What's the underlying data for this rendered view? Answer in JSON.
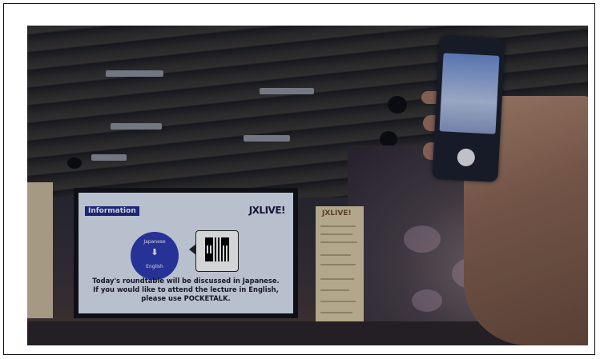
{
  "screen": {
    "info_label": "Information",
    "logo_text": "JXLIVE!",
    "circle_top": "Japanese",
    "circle_arrow": "⬇",
    "circle_bottom": "English",
    "message_line1": "Today's roundtable will be discussed in Japanese.",
    "message_line2": "If you would like to attend the lecture in English,",
    "message_line3": "please use POCKETALK."
  },
  "banner_right": {
    "title": "JXLIVE!"
  },
  "colors": {
    "screen_bg": "#dfe6f4",
    "accent_blue": "#2d3ab0",
    "info_tag": "#1e2b8a"
  }
}
